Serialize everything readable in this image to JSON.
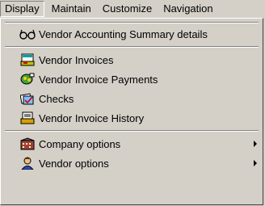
{
  "menubar": {
    "items": [
      {
        "label": "Display"
      },
      {
        "label": "Maintain"
      },
      {
        "label": "Customize"
      },
      {
        "label": "Navigation"
      }
    ]
  },
  "dropdown": {
    "items": [
      {
        "label": "Vendor Accounting Summary details",
        "icon": "glasses-icon"
      },
      {
        "label": "Vendor Invoices",
        "icon": "invoice-icon"
      },
      {
        "label": "Vendor Invoice Payments",
        "icon": "payments-icon"
      },
      {
        "label": "Checks",
        "icon": "checks-icon"
      },
      {
        "label": "Vendor Invoice History",
        "icon": "history-icon"
      },
      {
        "label": "Company options",
        "icon": "company-icon",
        "has_submenu": true
      },
      {
        "label": "Vendor options",
        "icon": "vendor-icon",
        "has_submenu": true
      }
    ]
  }
}
